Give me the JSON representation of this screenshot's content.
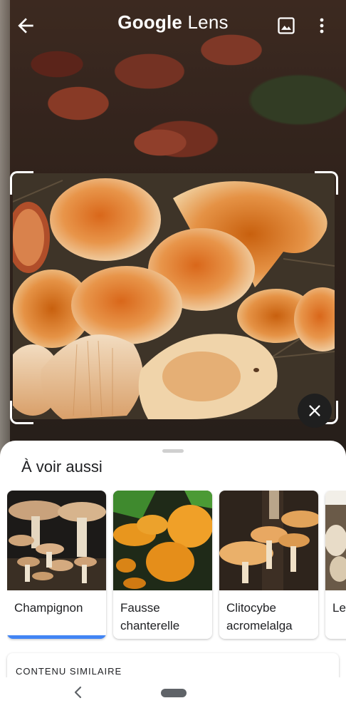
{
  "app": {
    "logo_part1": "Google",
    "logo_part2": "Lens"
  },
  "icons": {
    "back": "arrow-back-icon",
    "gallery": "image-gallery-icon",
    "more": "more-vert-icon",
    "close": "close-icon",
    "nav_back": "chevron-left-icon",
    "nav_home": "home-pill-icon"
  },
  "results": {
    "section_title": "À voir aussi",
    "items": [
      {
        "label": "Champignon",
        "selected": true
      },
      {
        "label": "Fausse chanterelle",
        "selected": false
      },
      {
        "label": "Clitocybe acromelalga",
        "selected": false
      },
      {
        "label": "Le",
        "selected": false
      }
    ],
    "similar_header": "CONTENU SIMILAIRE"
  },
  "colors": {
    "accent": "#4285f4",
    "fab": "#1f1f1f"
  }
}
